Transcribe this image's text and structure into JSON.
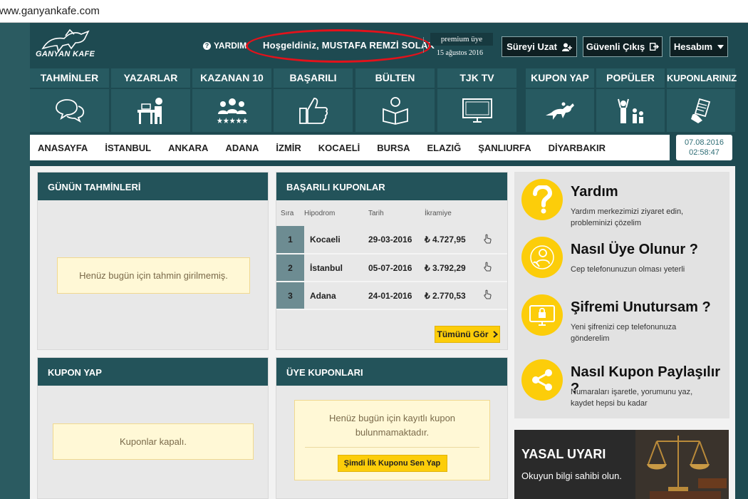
{
  "browser": {
    "url": "www.ganyankafe.com"
  },
  "header": {
    "logo_text": "GANYAN KAFE",
    "help_label": "YARDIM",
    "welcome": "Hoşgeldiniz, MUSTAFA REMZİ SOLAK",
    "premium_label": "premium üye",
    "premium_date": "15 ağustos 2016",
    "extend_label": "Süreyi Uzat",
    "logout_label": "Güvenli Çıkış",
    "account_label": "Hesabım"
  },
  "nav": [
    {
      "label": "TAHMİNLER",
      "icon": "speech-bubbles-icon"
    },
    {
      "label": "YAZARLAR",
      "icon": "writer-desk-icon"
    },
    {
      "label": "KAZANAN 10",
      "icon": "group-stars-icon"
    },
    {
      "label": "BAŞARILI",
      "icon": "thumbs-up-icon"
    },
    {
      "label": "BÜLTEN",
      "icon": "reading-person-icon"
    },
    {
      "label": "TJK TV",
      "icon": "tv-icon"
    },
    {
      "label": "KUPON YAP",
      "icon": "horse-racing-icon"
    },
    {
      "label": "POPÜLER",
      "icon": "cheering-crowd-icon"
    },
    {
      "label": "KUPONLARINIZ",
      "icon": "coupon-hand-icon"
    }
  ],
  "cities": [
    "ANASAYFA",
    "İSTANBUL",
    "ANKARA",
    "ADANA",
    "İZMİR",
    "KOCAELİ",
    "BURSA",
    "ELAZIĞ",
    "ŞANLIURFA",
    "DİYARBAKIR"
  ],
  "datetime": {
    "date": "07.08.2016",
    "time": "02:58:47"
  },
  "tahminler": {
    "title": "GÜNÜN TAHMİNLERİ",
    "notice": "Henüz bugün için tahmin girilmemiş."
  },
  "basarili": {
    "title": "BAŞARILI KUPONLAR",
    "columns": [
      "Sıra",
      "Hipodrom",
      "Tarih",
      "İkramiye"
    ],
    "rows": [
      {
        "rank": "1",
        "hipodrom": "Kocaeli",
        "tarih": "29-03-2016",
        "ikramiye": "₺ 4.727,95"
      },
      {
        "rank": "2",
        "hipodrom": "İstanbul",
        "tarih": "05-07-2016",
        "ikramiye": "₺ 3.792,29"
      },
      {
        "rank": "3",
        "hipodrom": "Adana",
        "tarih": "24-01-2016",
        "ikramiye": "₺ 2.770,53"
      }
    ],
    "see_all": "Tümünü Gör"
  },
  "kupon_yap": {
    "title": "KUPON YAP",
    "notice": "Kuponlar kapalı."
  },
  "uye_kuponlari": {
    "title": "ÜYE KUPONLARI",
    "notice_line1": "Henüz bugün için kayıtlı kupon",
    "notice_line2": "bulunmamaktadır.",
    "cta": "Şimdi İlk Kuponu Sen Yap"
  },
  "sidebar": [
    {
      "title": "Yardım",
      "desc_line1": "Yardım merkezimizi ziyaret edin,",
      "desc_line2": "probleminizi çözelim",
      "icon": "question-icon"
    },
    {
      "title": "Nasıl Üye Olunur ?",
      "desc_line1": "Cep telefonunuzun olması yeterli",
      "desc_line2": "",
      "icon": "user-touch-icon"
    },
    {
      "title": "Şifremi Unutursam ?",
      "desc_line1": "Yeni şifrenizi cep telefonunuza",
      "desc_line2": "gönderelim",
      "icon": "lock-monitor-icon"
    },
    {
      "title": "Nasıl Kupon Paylaşılır ?",
      "desc_line1": "Numaraları işaretle, yorumunu yaz,",
      "desc_line2": "kaydet hepsi bu kadar",
      "icon": "share-icon"
    }
  ],
  "yasal": {
    "title": "YASAL UYARI",
    "text": "Okuyun bilgi sahibi olun."
  },
  "colors": {
    "accent": "#fccd0a",
    "header_bg": "#1e4a51",
    "panel_title": "#23535a",
    "highlight_ellipse": "#e3121b"
  }
}
